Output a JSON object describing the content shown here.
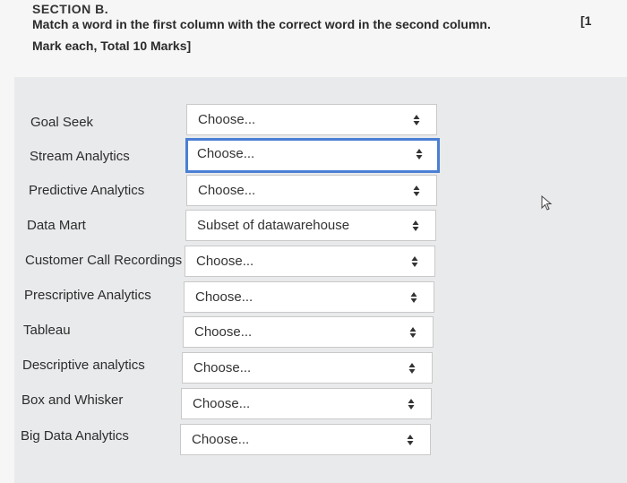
{
  "section": {
    "title": "SECTION B.",
    "instruction_line1": "Match a word in the first column with the correct word in the second column.",
    "instruction_line2": "Mark each, Total 10 Marks]",
    "marks_bracket": "[1"
  },
  "rows": [
    {
      "label": "Goal Seek",
      "value": "Choose..."
    },
    {
      "label": "Stream Analytics",
      "value": "Choose..."
    },
    {
      "label": "Predictive Analytics",
      "value": "Choose..."
    },
    {
      "label": "Data Mart",
      "value": "Subset of datawarehouse"
    },
    {
      "label": "Customer Call Recordings",
      "value": "Choose..."
    },
    {
      "label": "Prescriptive Analytics",
      "value": "Choose..."
    },
    {
      "label": "Tableau",
      "value": "Choose..."
    },
    {
      "label": "Descriptive analytics",
      "value": "Choose..."
    },
    {
      "label": "Box and Whisker",
      "value": "Choose..."
    },
    {
      "label": "Big Data Analytics",
      "value": "Choose..."
    }
  ],
  "icons": {
    "select_arrow": "up-down-arrows-icon",
    "cursor": "mouse-pointer-icon"
  },
  "colors": {
    "focus_border": "#4a7fd4",
    "panel_bg": "#e9eaec"
  }
}
